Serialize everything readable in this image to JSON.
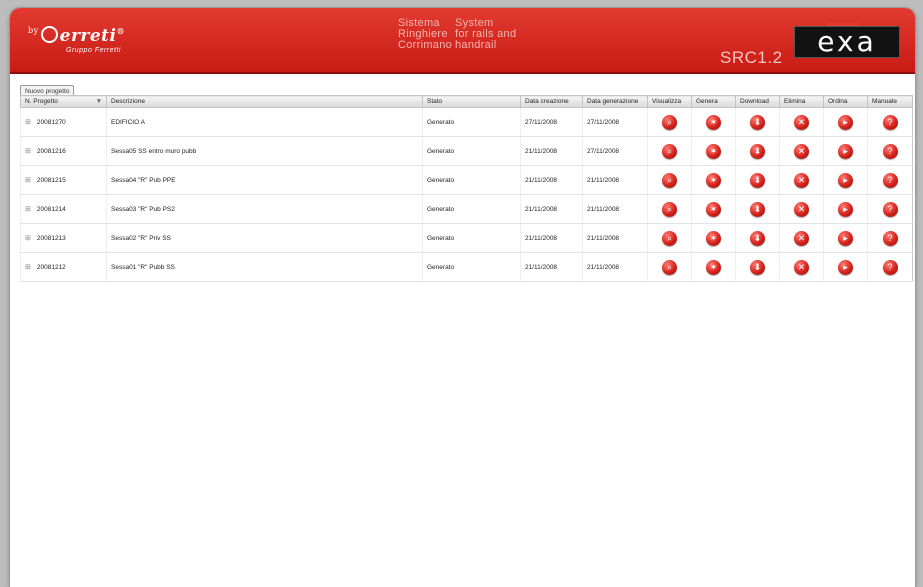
{
  "brand": {
    "by": "by",
    "name": "erreti",
    "trademark": "®",
    "subline": "Gruppo Ferretti"
  },
  "tagline": {
    "it": [
      "Sistema",
      "Ringhiere",
      "Corrimano"
    ],
    "en": [
      "System",
      "for rails and",
      "handrail"
    ]
  },
  "version": "SRC1.2",
  "logo": "exa",
  "colors": {
    "header_red": "#d42a22",
    "icon_red": "#d4231b"
  },
  "toolbar": {
    "new_project_label": "Nuovo progetto"
  },
  "table": {
    "columns": [
      "N. Progetto",
      "Descrizione",
      "Stato",
      "Data creazione",
      "Data generazione",
      "Visualizza",
      "Genera",
      "Download",
      "Elimina",
      "Ordina",
      "Manuale"
    ],
    "sort_icon": "filter-icon",
    "action_icons": [
      "view-icon",
      "generate-icon",
      "download-icon",
      "delete-icon",
      "order-icon",
      "manual-icon"
    ],
    "rows": [
      {
        "id": "20081270",
        "desc": "EDIFICIO A",
        "stato": "Generato",
        "created": "27/11/2008",
        "generated": "27/11/2008"
      },
      {
        "id": "20081216",
        "desc": "Sessa05 SS entro muro pubb",
        "stato": "Generato",
        "created": "21/11/2008",
        "generated": "27/11/2008"
      },
      {
        "id": "20081215",
        "desc": "Sessa04 \"R\" Pub PPE",
        "stato": "Generato",
        "created": "21/11/2008",
        "generated": "21/11/2008"
      },
      {
        "id": "20081214",
        "desc": "Sessa03 \"R\" Pub PS2",
        "stato": "Generato",
        "created": "21/11/2008",
        "generated": "21/11/2008"
      },
      {
        "id": "20081213",
        "desc": "Sessa02 \"R\" Priv SS",
        "stato": "Generato",
        "created": "21/11/2008",
        "generated": "21/11/2008"
      },
      {
        "id": "20081212",
        "desc": "Sessa01 \"R\" Pubb SS",
        "stato": "Generato",
        "created": "21/11/2008",
        "generated": "21/11/2008"
      }
    ]
  }
}
